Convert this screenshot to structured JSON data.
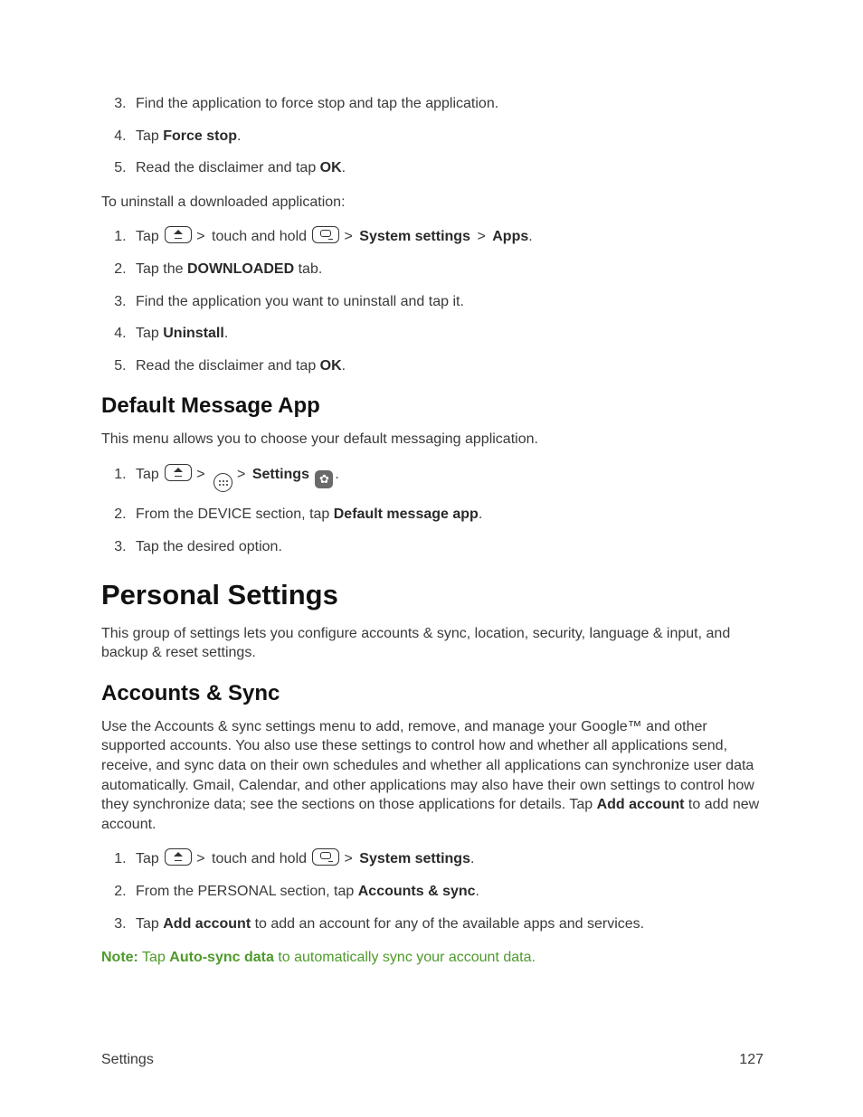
{
  "sep": ">",
  "list_a": {
    "i3": "Find the application to force stop and tap the application.",
    "i4_pre": "Tap ",
    "i4_b": "Force stop",
    "i4_post": ".",
    "i5_pre": "Read the disclaimer and tap ",
    "i5_b": "OK",
    "i5_post": "."
  },
  "uninstall_intro": "To uninstall a downloaded application:",
  "list_b": {
    "i1_pre": "Tap ",
    "i1_mid": " touch and hold ",
    "i1_b1": "System settings",
    "i1_b2": "Apps",
    "i1_post": ".",
    "i2_pre": "Tap the ",
    "i2_b": "DOWNLOADED",
    "i2_post": " tab.",
    "i3": "Find the application you want to uninstall and tap it.",
    "i4_pre": "Tap ",
    "i4_b": "Uninstall",
    "i4_post": ".",
    "i5_pre": "Read the disclaimer and tap ",
    "i5_b": "OK",
    "i5_post": "."
  },
  "h_dma": "Default Message App",
  "dma_intro": "This menu allows you to choose your default messaging application.",
  "list_c": {
    "i1_pre": "Tap ",
    "i1_b": "Settings",
    "i1_post": ".",
    "i2_pre": "From the DEVICE section, tap ",
    "i2_b": "Default message app",
    "i2_post": ".",
    "i3": "Tap the desired option."
  },
  "h_personal": "Personal Settings",
  "personal_intro": "This group of settings lets you configure accounts & sync, location, security, language & input, and backup & reset settings.",
  "h_accounts": "Accounts & Sync",
  "accounts_intro_pre": "Use the Accounts & sync settings menu to add, remove, and manage your Google™ and other supported accounts. You also use these settings to control how and whether all applications send, receive, and sync data on their own schedules and whether all applications can synchronize user data automatically. Gmail, Calendar, and other applications may also have their own settings to control how they synchronize data; see the sections on those applications for details. Tap ",
  "accounts_intro_b": "Add account",
  "accounts_intro_post": " to add new account.",
  "list_d": {
    "i1_pre": "Tap ",
    "i1_mid": " touch and hold ",
    "i1_b1": "System settings",
    "i1_post": ".",
    "i2_pre": "From the PERSONAL section, tap ",
    "i2_b": "Accounts & sync",
    "i2_post": ".",
    "i3_pre": "Tap ",
    "i3_b": "Add account",
    "i3_post": " to add an account for any of the available apps and services."
  },
  "note_pre": "Note:",
  "note_mid1": " Tap ",
  "note_b": "Auto-sync data",
  "note_post": " to automatically sync your account data.",
  "footer_left": "Settings",
  "footer_right": "127"
}
